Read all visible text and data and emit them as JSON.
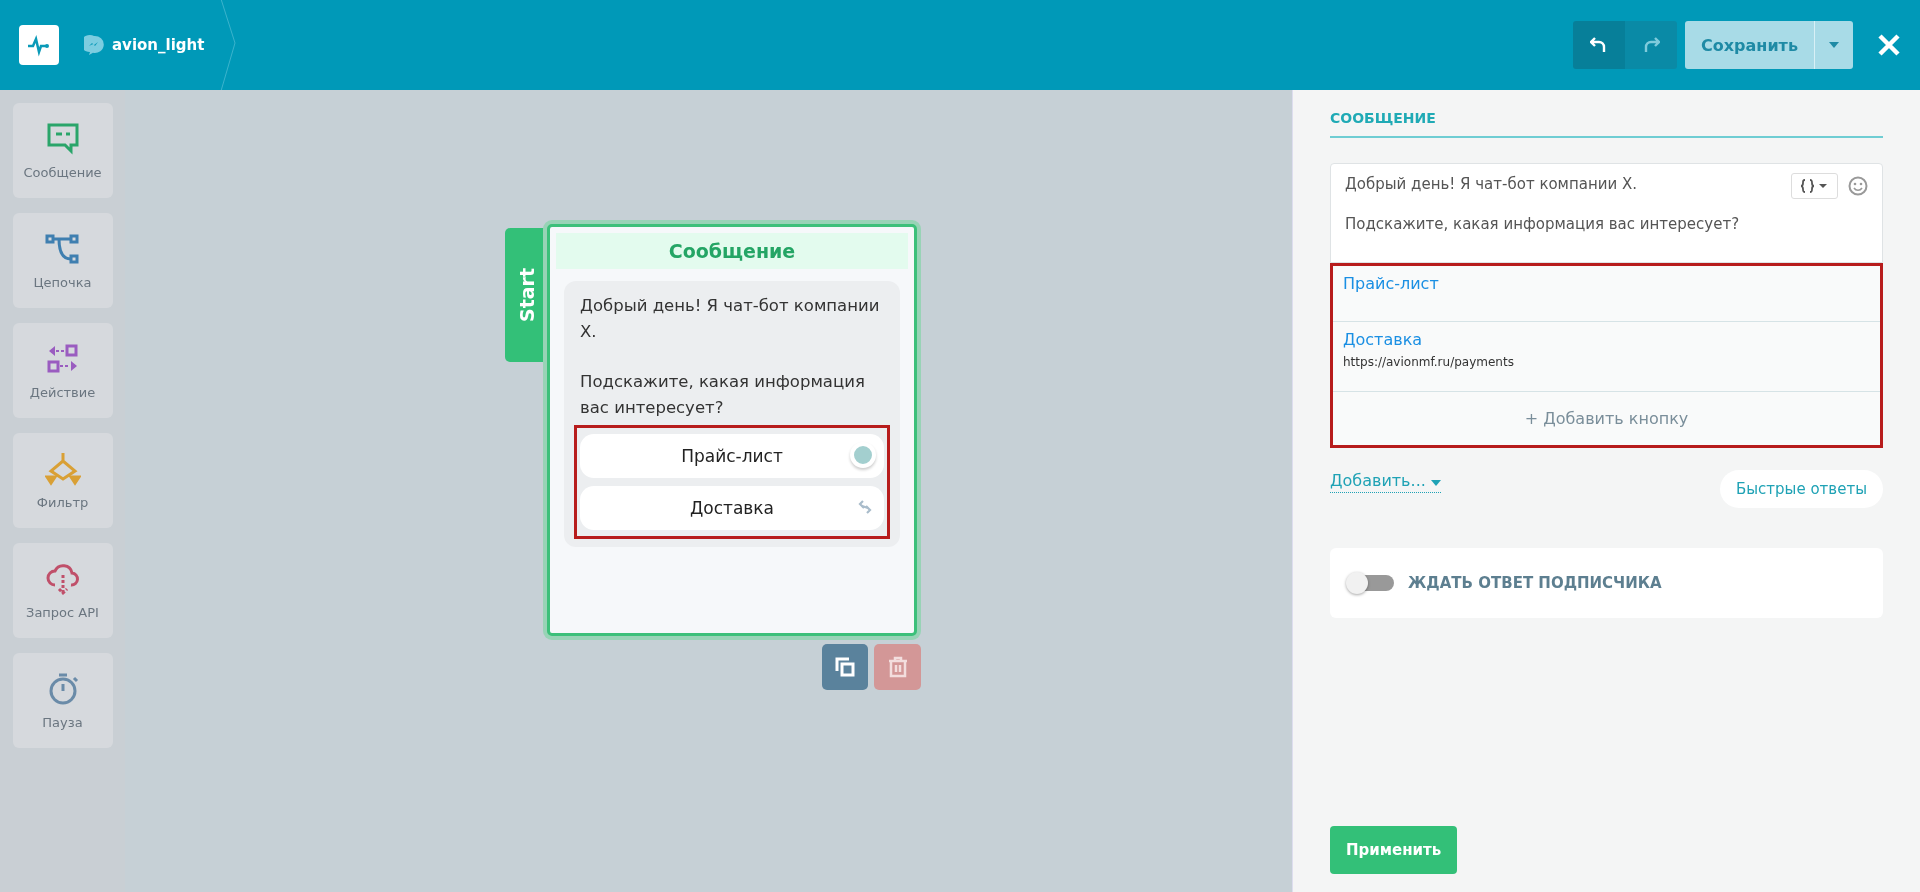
{
  "header": {
    "bot_name": "avion_light",
    "save_button": "Сохранить"
  },
  "sidebar": {
    "items": [
      {
        "label": "Сообщение"
      },
      {
        "label": "Цепочка"
      },
      {
        "label": "Действие"
      },
      {
        "label": "Фильтр"
      },
      {
        "label": "Запрос API"
      },
      {
        "label": "Пауза"
      }
    ]
  },
  "node": {
    "start_label": "Start",
    "title": "Сообщение",
    "message_lines": [
      "Добрый день! Я чат-бот компании X.",
      "Подскажите, какая информация вас интересует?"
    ],
    "buttons": [
      {
        "label": "Прайс-лист",
        "kind": "connector"
      },
      {
        "label": "Доставка",
        "kind": "link"
      }
    ]
  },
  "panel": {
    "title": "СООБЩЕНИЕ",
    "message_lines": [
      "Добрый день! Я чат-бот компании X.",
      "Подскажите, какая информация вас интересует?"
    ],
    "buttons": [
      {
        "label": "Прайс-лист"
      },
      {
        "label": "Доставка",
        "url": "https://avionmf.ru/payments"
      }
    ],
    "add_button": "+ Добавить кнопку",
    "add_menu": "Добавить...",
    "quick_replies": "Быстрые ответы",
    "wait_reply": {
      "label": "ЖДАТЬ ОТВЕТ ПОДПИСЧИКА",
      "on": false
    },
    "apply": "Применить"
  }
}
